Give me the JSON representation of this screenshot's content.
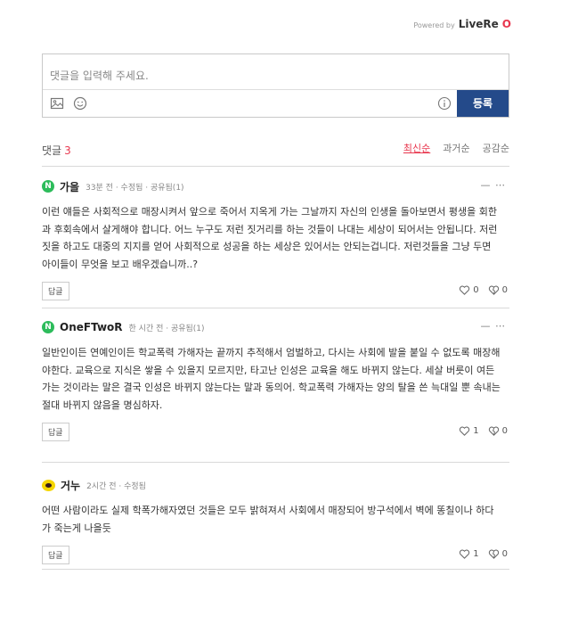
{
  "powered": {
    "prefix": "Powered by",
    "brand": "LiveRe",
    "brand_mark": "O"
  },
  "editor": {
    "placeholder": "댓글을 입력해 주세요.",
    "submit_label": "등록",
    "icons": [
      "image-icon",
      "emoji-icon",
      "info-icon"
    ]
  },
  "comments_header": {
    "label": "댓글",
    "count": "3",
    "sort_options": [
      "최신순",
      "과거순",
      "공감순"
    ],
    "active_sort": "최신순"
  },
  "comments": [
    {
      "avatar": "naver-n-icon",
      "avatar_letter": "N",
      "author": "가을",
      "meta": "33분 전 · 수정됨 · 공유됨(1)",
      "body": "이런 얘들은 사회적으로 매장시켜서 앞으로 죽어서 지옥게 가는 그날까지 자신의 인생을 돌아보면서 평생을 회한과 후회속에서 살게해야 합니다. 어느 누구도 저런 짓거리를 하는 것들이 나대는 세상이 되어서는 안됩니다. 저런 짓을 하고도 대중의 지지를 얻어 사회적으로 성공을 하는 세상은 있어서는 안되는겁니다. 저런것들을 그냥 두면 아이들이 무엇을 보고 배우겠습니까..?",
      "reply_label": "답글",
      "likes": "0",
      "dislikes": "0"
    },
    {
      "avatar": "naver-n-icon",
      "avatar_letter": "N",
      "author": "OneFTwoR",
      "meta": "한 시간 전 · 공유됨(1)",
      "body": "일반인이든 연예인이든 학교폭력 가해자는 끝까지 추적해서 엄벌하고, 다시는 사회에 발을 붙일 수 없도록 매장해야한다. 교육으로 지식은 쌓을 수 있을지 모르지만, 타고난 인성은 교육을 해도 바뀌지 않는다. 세살 버릇이 여든 가는 것이라는 말은 결국 인성은 바뀌지 않는다는 말과 동의어. 학교폭력 가해자는 양의 탈을 쓴 늑대일 뿐 속내는 절대 바뀌지 않음을 명심하자.",
      "reply_label": "답글",
      "likes": "1",
      "dislikes": "0"
    },
    {
      "avatar": "kakao-icon",
      "avatar_letter": "",
      "author": "거누",
      "meta": "2시간 전 · 수정됨",
      "body": "어떤 사람이라도 실제 학폭가해자였던 것들은 모두 밝혀져서 사회에서 매장되어 방구석에서 벽에 똥칠이나 하다가 죽는게 나을듯",
      "reply_label": "답글",
      "likes": "1",
      "dislikes": "0"
    }
  ],
  "colors": {
    "accent": "#e8384f",
    "submit": "#244a8a",
    "naver": "#2dbc5b",
    "kakao": "#f5d600"
  }
}
